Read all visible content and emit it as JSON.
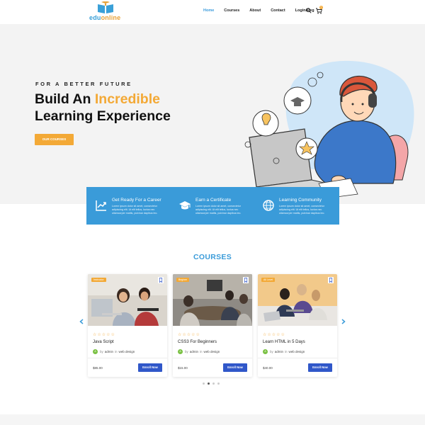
{
  "logo": {
    "part1": "edu",
    "part2": "online"
  },
  "nav": {
    "items": [
      "Home",
      "Courses",
      "About",
      "Contact",
      "Login/Reg"
    ],
    "cart_count": "0"
  },
  "hero": {
    "eyebrow": "FOR A BETTER FUTURE",
    "title_pre": "Build An ",
    "title_accent": "Incredible",
    "title_line2": "Learning Experience",
    "button": "OUR COURSES"
  },
  "features": [
    {
      "icon": "chart-growth-icon",
      "title": "Get Ready For a Career",
      "text": "Lorem ipsum dolor sit amet, consectetur adipiscing elit. Ut elit tellus, luctus nec ullamcorper mattis, pulvinar dapibus leo."
    },
    {
      "icon": "graduation-cap-icon",
      "title": "Earn a Certificate",
      "text": "Lorem ipsum dolor sit amet, consectetur adipiscing elit. Ut elit tellus, luctus nec ullamcorper mattis, pulvinar dapibus leo."
    },
    {
      "icon": "globe-icon",
      "title": "Learning Community",
      "text": "Lorem ipsum dolor sit amet, consectetur adipiscing elit. Ut elit tellus, luctus nec ullamcorper mattis, pulvinar dapibus leo."
    }
  ],
  "courses": {
    "heading": "COURSES",
    "cards": [
      {
        "badge": "Instructor",
        "stars": "☆☆☆☆☆",
        "title": "Java Script",
        "by": "by",
        "author": "admin",
        "in": "in",
        "category": "web design",
        "price": "$85.00",
        "button": "Enroll Now"
      },
      {
        "badge": "Beginer",
        "stars": "☆☆☆☆☆",
        "title": "CSS3 For Beginners",
        "by": "by",
        "author": "admin",
        "in": "in",
        "category": "web design",
        "price": "$15.00",
        "button": "Enroll Now"
      },
      {
        "badge": "All Level",
        "stars": "☆☆☆☆☆",
        "title": "Learn HTML in 5 Days",
        "by": "by",
        "author": "admin",
        "in": "in",
        "category": "web design",
        "price": "$40.00",
        "button": "Enroll Now"
      }
    ],
    "avatar_letter": "A"
  },
  "colors": {
    "accent": "#f3a936",
    "primary": "#3a9bd9",
    "button": "#3057c9"
  }
}
